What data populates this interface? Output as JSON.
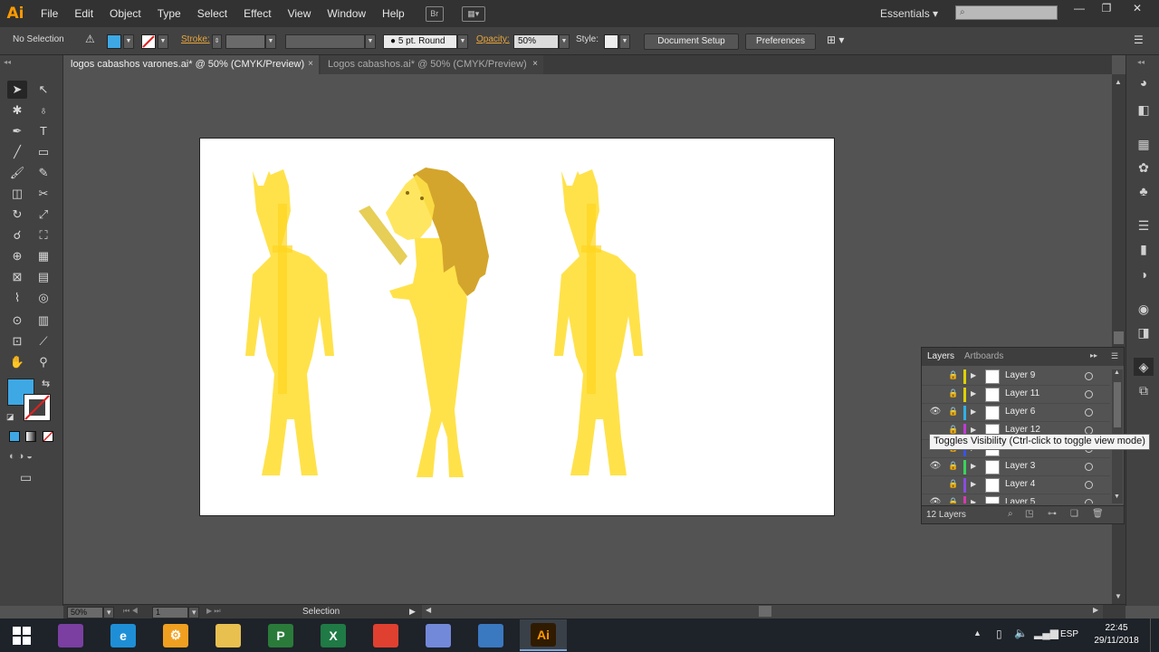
{
  "app": {
    "logo": "Ai",
    "workspace": "Essentials ▾"
  },
  "menu": [
    "File",
    "Edit",
    "Object",
    "Type",
    "Select",
    "Effect",
    "View",
    "Window",
    "Help"
  ],
  "window_controls": {
    "minimize": "—",
    "restore": "❐",
    "close": "✕"
  },
  "control_bar": {
    "selection_label": "No Selection",
    "fill_color": "#3ea8e5",
    "stroke_label": "Stroke:",
    "brush_label": "5 pt. Round",
    "opacity_label": "Opacity:",
    "opacity_value": "50%",
    "style_label": "Style:",
    "doc_setup_button": "Document Setup",
    "preferences_button": "Preferences"
  },
  "tabs": [
    {
      "label": "logos cabashos varones.ai* @ 50% (CMYK/Preview)",
      "close": "×"
    },
    {
      "label": "Logos cabashos.ai* @ 50% (CMYK/Preview)",
      "close": "×"
    }
  ],
  "tools": {
    "fill_color": "#3ea8e5",
    "icons": [
      "selection-tool",
      "direct-selection-tool",
      "magic-wand-tool",
      "lasso-tool",
      "pen-tool",
      "type-tool",
      "line-tool",
      "rectangle-tool",
      "paintbrush-tool",
      "pencil-tool",
      "eraser-tool",
      "scissors-tool",
      "rotate-tool",
      "scale-tool",
      "warp-tool",
      "free-transform-tool",
      "shape-builder-tool",
      "perspective-grid-tool",
      "mesh-tool",
      "gradient-tool",
      "eyedropper-tool",
      "blend-tool",
      "symbol-sprayer-tool",
      "column-graph-tool",
      "artboard-tool",
      "slice-tool",
      "hand-tool",
      "zoom-tool"
    ]
  },
  "artwork": {
    "figure_colors": {
      "body": "#ffe24a",
      "body_dark": "#ffd51f",
      "mane": "#d4a52c",
      "arm": "#e2c639"
    }
  },
  "layers_panel": {
    "tab_layers": "Layers",
    "tab_artboards": "Artboards",
    "rows": [
      {
        "name": "Layer 9",
        "visible": false,
        "color": "#e0d000"
      },
      {
        "name": "Layer 11",
        "visible": false,
        "color": "#e0d000"
      },
      {
        "name": "Layer 6",
        "visible": true,
        "color": "#2fb0e8"
      },
      {
        "name": "Layer 12",
        "visible": false,
        "color": "#c23ad6"
      },
      {
        "name": "",
        "visible": false,
        "color": "#3a55e0"
      },
      {
        "name": "Layer 3",
        "visible": true,
        "color": "#3ad35a"
      },
      {
        "name": "Layer 4",
        "visible": false,
        "color": "#8a4ce0"
      },
      {
        "name": "Layer 5",
        "visible": true,
        "color": "#d63ab0"
      }
    ],
    "count_label": "12 Layers",
    "tooltip": "Toggles Visibility (Ctrl-click to toggle view mode)"
  },
  "status_bar": {
    "zoom": "50%",
    "artboard_num": "1",
    "tool_label": "Selection"
  },
  "taskbar": {
    "apps": [
      {
        "name": "winrar",
        "label": "",
        "color": "#7a3fa0"
      },
      {
        "name": "internet-explorer",
        "label": "e",
        "color": "#1e8fd6"
      },
      {
        "name": "settings-app",
        "label": "⚙",
        "color": "#f0a020"
      },
      {
        "name": "file-explorer",
        "label": "",
        "color": "#e8c050"
      },
      {
        "name": "project",
        "label": "P",
        "color": "#2a7a3a"
      },
      {
        "name": "excel",
        "label": "X",
        "color": "#1f7a45"
      },
      {
        "name": "chrome",
        "label": "",
        "color": "#e04030"
      },
      {
        "name": "discord",
        "label": "",
        "color": "#7289da"
      },
      {
        "name": "photos",
        "label": "",
        "color": "#3a78c0"
      },
      {
        "name": "illustrator",
        "label": "Ai",
        "color": "#ff9a00"
      }
    ],
    "language": "ESP",
    "time": "22:45",
    "date": "29/11/2018"
  }
}
